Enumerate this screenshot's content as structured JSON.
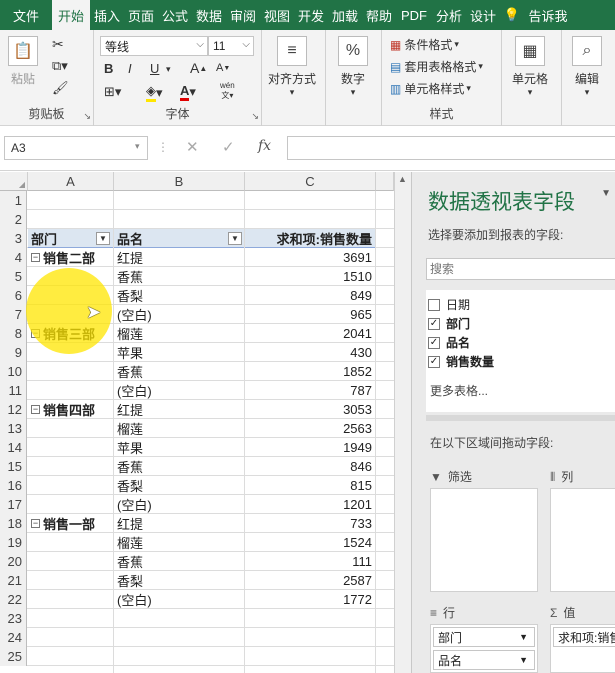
{
  "tabs": [
    "文件",
    "开始",
    "插入",
    "页面",
    "公式",
    "数据",
    "审阅",
    "视图",
    "开发",
    "加载",
    "帮助",
    "PDF",
    "分析",
    "设计",
    "告诉我"
  ],
  "active_tab": "开始",
  "ribbon": {
    "clipboard": {
      "paste": "粘贴",
      "label": "剪贴板"
    },
    "font": {
      "name": "等线",
      "size": "11",
      "label": "字体",
      "bold": "B",
      "italic": "I",
      "underline": "U",
      "grow": "A",
      "shrink": "A",
      "font_color": "A",
      "wen": "wén"
    },
    "align": {
      "label": "对齐方式"
    },
    "number": {
      "label": "数字",
      "symbol": "%"
    },
    "styles": {
      "cond": "条件格式",
      "table": "套用表格格式",
      "cell": "单元格样式",
      "label": "样式"
    },
    "cells": {
      "label": "单元格"
    },
    "edit": {
      "label": "编辑"
    }
  },
  "namebox": "A3",
  "fx": "fx",
  "columns": [
    "A",
    "B",
    "C"
  ],
  "rows": [
    {
      "n": "1",
      "a": "",
      "b": "",
      "c": ""
    },
    {
      "n": "2",
      "a": "",
      "b": "",
      "c": ""
    },
    {
      "n": "3",
      "a": "部门",
      "b": "品名",
      "c": "求和项:销售数量",
      "header": true
    },
    {
      "n": "4",
      "a": "销售二部",
      "b": "红提",
      "c": "3691",
      "group": true
    },
    {
      "n": "5",
      "a": "",
      "b": "香蕉",
      "c": "1510"
    },
    {
      "n": "6",
      "a": "",
      "b": "香梨",
      "c": "849"
    },
    {
      "n": "7",
      "a": "",
      "b": "(空白)",
      "c": "965"
    },
    {
      "n": "8",
      "a": "销售三部",
      "b": "榴莲",
      "c": "2041",
      "group": true
    },
    {
      "n": "9",
      "a": "",
      "b": "苹果",
      "c": "430"
    },
    {
      "n": "10",
      "a": "",
      "b": "香蕉",
      "c": "1852"
    },
    {
      "n": "11",
      "a": "",
      "b": "(空白)",
      "c": "787"
    },
    {
      "n": "12",
      "a": "销售四部",
      "b": "红提",
      "c": "3053",
      "group": true
    },
    {
      "n": "13",
      "a": "",
      "b": "榴莲",
      "c": "2563"
    },
    {
      "n": "14",
      "a": "",
      "b": "苹果",
      "c": "1949"
    },
    {
      "n": "15",
      "a": "",
      "b": "香蕉",
      "c": "846"
    },
    {
      "n": "16",
      "a": "",
      "b": "香梨",
      "c": "815"
    },
    {
      "n": "17",
      "a": "",
      "b": "(空白)",
      "c": "1201"
    },
    {
      "n": "18",
      "a": "销售一部",
      "b": "红提",
      "c": "733",
      "group": true
    },
    {
      "n": "19",
      "a": "",
      "b": "榴莲",
      "c": "1524"
    },
    {
      "n": "20",
      "a": "",
      "b": "香蕉",
      "c": "111"
    },
    {
      "n": "21",
      "a": "",
      "b": "香梨",
      "c": "2587"
    },
    {
      "n": "22",
      "a": "",
      "b": "(空白)",
      "c": "1772"
    },
    {
      "n": "23",
      "a": "",
      "b": "",
      "c": ""
    },
    {
      "n": "24",
      "a": "",
      "b": "",
      "c": ""
    },
    {
      "n": "25",
      "a": "",
      "b": "",
      "c": ""
    }
  ],
  "panel": {
    "title": "数据透视表字段",
    "subtitle": "选择要添加到报表的字段:",
    "search_placeholder": "搜索",
    "fields": [
      {
        "label": "日期",
        "checked": false
      },
      {
        "label": "部门",
        "checked": true
      },
      {
        "label": "品名",
        "checked": true
      },
      {
        "label": "销售数量",
        "checked": true
      }
    ],
    "more": "更多表格...",
    "drag_hint": "在以下区域间拖动字段:",
    "filter_label": "筛选",
    "columns_label": "列",
    "rows_label": "行",
    "values_label": "值",
    "row_items": [
      "部门",
      "品名"
    ],
    "value_items": [
      "求和项:销售"
    ]
  },
  "colors": {
    "accent": "#217346",
    "pivot_header": "#dce6f1",
    "highlight": "#ffe600"
  }
}
